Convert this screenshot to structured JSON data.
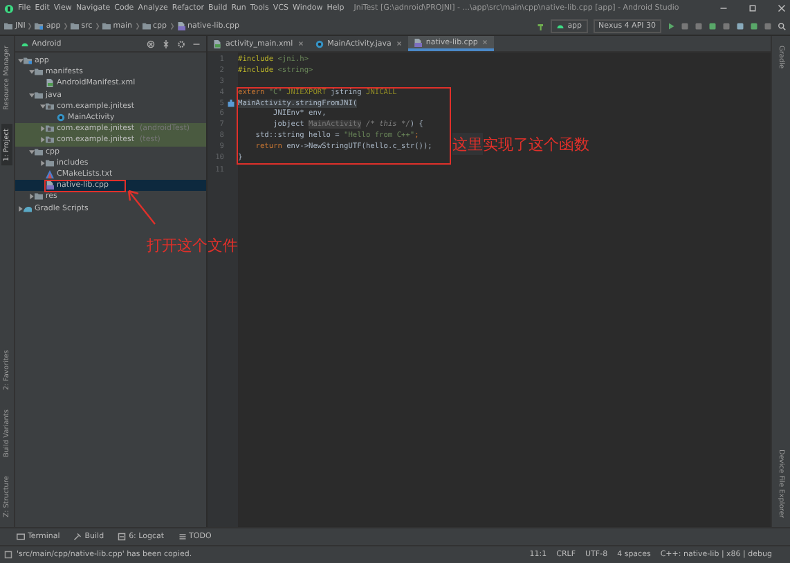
{
  "window": {
    "title": "JniTest [G:\\adnroid\\PROJNI] - ...\\app\\src\\main\\cpp\\native-lib.cpp [app] - Android Studio"
  },
  "menu": [
    "File",
    "Edit",
    "View",
    "Navigate",
    "Code",
    "Analyze",
    "Refactor",
    "Build",
    "Run",
    "Tools",
    "VCS",
    "Window",
    "Help"
  ],
  "breadcrumbs": [
    {
      "label": "JNI",
      "kind": "folder"
    },
    {
      "label": "app",
      "kind": "module"
    },
    {
      "label": "src",
      "kind": "folder"
    },
    {
      "label": "main",
      "kind": "folder"
    },
    {
      "label": "cpp",
      "kind": "folder"
    },
    {
      "label": "native-lib.cpp",
      "kind": "cpp"
    }
  ],
  "toolbar": {
    "run_config": "app",
    "device": "Nexus 4 API 30"
  },
  "left_strip": {
    "top": [
      {
        "label": "Resource Manager",
        "selected": false
      },
      {
        "label": "1: Project",
        "selected": true
      }
    ],
    "bottom": [
      {
        "label": "2: Favorites",
        "selected": false
      },
      {
        "label": "Build Variants",
        "selected": false
      },
      {
        "label": "Z: Structure",
        "selected": false
      }
    ]
  },
  "right_strip": {
    "top": [
      "Gradle"
    ],
    "bottom": [
      "Device File Explorer"
    ]
  },
  "project": {
    "view": "Android",
    "tree": [
      {
        "label": "app",
        "kind": "module",
        "expanded": true,
        "selected": false,
        "test_root": false,
        "boxed": false,
        "children": [
          {
            "label": "manifests",
            "kind": "folder",
            "expanded": true,
            "selected": false,
            "test_root": false,
            "boxed": false,
            "children": [
              {
                "label": "AndroidManifest.xml",
                "kind": "xml",
                "selected": false,
                "test_root": false,
                "boxed": false
              }
            ]
          },
          {
            "label": "java",
            "kind": "folder",
            "expanded": true,
            "selected": false,
            "test_root": false,
            "boxed": false,
            "children": [
              {
                "label": "com.example.jnitest",
                "kind": "package",
                "expanded": true,
                "selected": false,
                "test_root": false,
                "boxed": false,
                "children": [
                  {
                    "label": "MainActivity",
                    "kind": "class",
                    "selected": false,
                    "test_root": false,
                    "boxed": false
                  }
                ]
              },
              {
                "label": "com.example.jnitest",
                "suffix": "(androidTest)",
                "kind": "package",
                "expanded": false,
                "selected": false,
                "test_root": true,
                "boxed": false
              },
              {
                "label": "com.example.jnitest",
                "suffix": "(test)",
                "kind": "package",
                "expanded": false,
                "selected": false,
                "test_root": true,
                "boxed": false
              }
            ]
          },
          {
            "label": "cpp",
            "kind": "folder",
            "expanded": true,
            "selected": false,
            "test_root": false,
            "boxed": false,
            "children": [
              {
                "label": "includes",
                "kind": "folder",
                "expanded": false,
                "selected": false,
                "test_root": false,
                "boxed": false
              },
              {
                "label": "CMakeLists.txt",
                "kind": "cmake",
                "selected": false,
                "test_root": false,
                "boxed": false
              },
              {
                "label": "native-lib.cpp",
                "kind": "cpp",
                "selected": true,
                "test_root": false,
                "boxed": true
              }
            ]
          },
          {
            "label": "res",
            "kind": "folder",
            "expanded": false,
            "selected": false,
            "test_root": false,
            "boxed": false
          }
        ]
      },
      {
        "label": "Gradle Scripts",
        "kind": "gradle",
        "expanded": false,
        "selected": false,
        "test_root": false,
        "boxed": false
      }
    ]
  },
  "editor": {
    "tabs": [
      {
        "label": "activity_main.xml",
        "kind": "xml",
        "selected": false
      },
      {
        "label": "MainActivity.java",
        "kind": "class",
        "selected": false
      },
      {
        "label": "native-lib.cpp",
        "kind": "cpp",
        "selected": true
      }
    ],
    "blocks": [
      {
        "boxed": false,
        "lines": [
          {
            "number": "1",
            "marker": false,
            "tokens": [
              {
                "text": "#include ",
                "kind": "directive"
              },
              {
                "text": "<jni.h>",
                "kind": "string"
              }
            ]
          },
          {
            "number": "2",
            "marker": false,
            "tokens": [
              {
                "text": "#include ",
                "kind": "directive"
              },
              {
                "text": "<string>",
                "kind": "string"
              }
            ]
          },
          {
            "number": "3",
            "marker": false
          }
        ]
      },
      {
        "boxed": true,
        "lines": [
          {
            "number": "4",
            "marker": false,
            "tokens": [
              {
                "text": "extern ",
                "kind": "keyword"
              },
              {
                "text": "\"C\" ",
                "kind": "string"
              },
              {
                "text": "JNIEXPORT ",
                "kind": "macro"
              },
              {
                "text": "jstring ",
                "kind": "plain"
              },
              {
                "text": "JNICALL",
                "kind": "macro"
              }
            ]
          },
          {
            "number": "5",
            "marker": true,
            "tokens": [
              {
                "text": "MainActivity.stringFromJNI(",
                "kind": "folded"
              }
            ]
          },
          {
            "number": "6",
            "marker": false,
            "tokens": [
              {
                "text": "        JNIEnv* env,",
                "kind": "plain"
              }
            ]
          },
          {
            "number": "7",
            "marker": false,
            "tokens": [
              {
                "text": "        jobject ",
                "kind": "plain"
              },
              {
                "text": "MainActivity",
                "kind": "hint"
              },
              {
                "text": " /* this */",
                "kind": "comment"
              },
              {
                "text": ") {",
                "kind": "plain"
              }
            ]
          },
          {
            "number": "8",
            "marker": false,
            "tokens": [
              {
                "text": "    std::string hello = ",
                "kind": "plain"
              },
              {
                "text": "\"Hello from C++\"",
                "kind": "string"
              },
              {
                "text": ";",
                "kind": "keyword"
              }
            ]
          },
          {
            "number": "9",
            "marker": false,
            "tokens": [
              {
                "text": "    return ",
                "kind": "keyword"
              },
              {
                "text": "env->NewStringUTF(hello.c_str());",
                "kind": "plain"
              }
            ]
          },
          {
            "number": "10",
            "marker": false,
            "tokens": [
              {
                "text": "}",
                "kind": "plain"
              }
            ]
          }
        ]
      },
      {
        "boxed": false,
        "lines": [
          {
            "number": "11",
            "marker": false
          }
        ]
      }
    ]
  },
  "annotations": {
    "file_note": "打开这个文件",
    "code_note": "这里实现了这个函数"
  },
  "tool_tabs": [
    {
      "label": "Terminal",
      "kind": "terminal"
    },
    {
      "label": "Build",
      "kind": "build"
    },
    {
      "label": "6: Logcat",
      "kind": "logcat"
    },
    {
      "label": "TODO",
      "kind": "todo"
    }
  ],
  "status_bar": {
    "message": "'src/main/cpp/native-lib.cpp' has been copied.",
    "items": [
      "11:1",
      "CRLF",
      "UTF-8",
      "4 spaces",
      "C++: native-lib | x86 | debug"
    ]
  }
}
